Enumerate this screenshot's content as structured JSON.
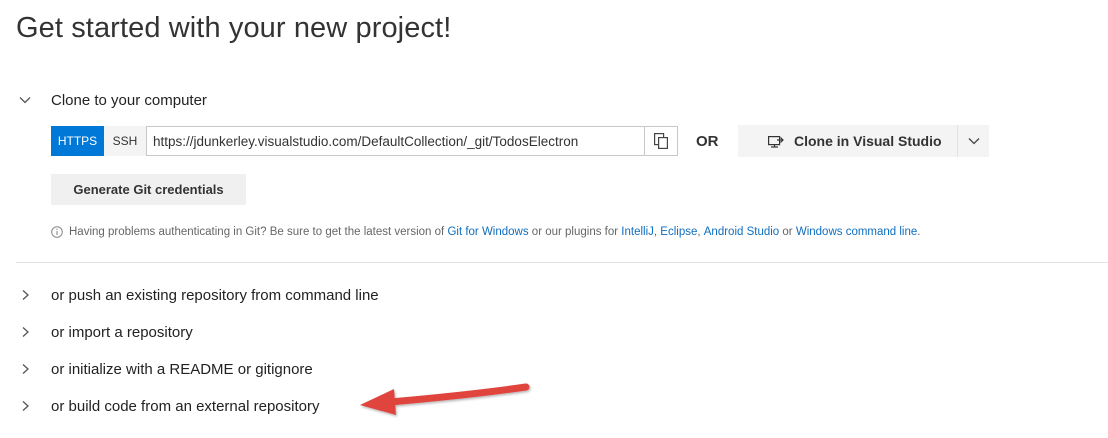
{
  "page": {
    "title": "Get started with your new project!"
  },
  "clone_section": {
    "label": "Clone to your computer",
    "expanded": true,
    "protocols": [
      {
        "label": "HTTPS",
        "selected": true
      },
      {
        "label": "SSH",
        "selected": false
      }
    ],
    "url_value": "https://jdunkerley.visualstudio.com/DefaultCollection/_git/TodosElectron",
    "or_label": "OR",
    "clone_vs_label": "Clone in Visual Studio",
    "generate_credentials_label": "Generate Git credentials",
    "help": {
      "text_1": "Having problems authenticating in Git? Be sure to get the latest version of ",
      "link_git_for_windows": "Git for Windows",
      "text_2": " or our plugins for ",
      "link_intellij": "IntelliJ",
      "text_3": ", ",
      "link_eclipse": "Eclipse",
      "text_4": ", ",
      "link_android_studio": "Android Studio",
      "text_5": " or ",
      "link_windows_command_line": "Windows command line",
      "text_6": "."
    }
  },
  "collapsed_sections": [
    {
      "label": "or push an existing repository from command line"
    },
    {
      "label": "or import a repository"
    },
    {
      "label": "or initialize with a README or gitignore"
    },
    {
      "label": "or build code from an external repository"
    }
  ],
  "colors": {
    "accent": "#0078d7",
    "link": "#106ebe",
    "annotation_arrow": "#e0443e"
  },
  "icons": {
    "expand": "chevron-down-icon",
    "collapsed": "chevron-right-icon",
    "copy": "copy-icon",
    "clone": "clone-vs-icon",
    "dropdown": "chevron-down-icon",
    "info": "info-icon",
    "annotation": "red-arrow"
  }
}
